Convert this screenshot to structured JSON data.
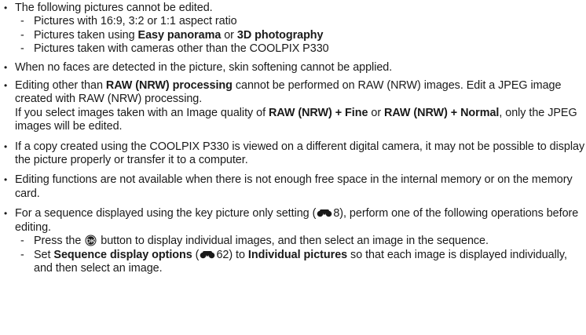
{
  "bullets": {
    "b1": {
      "text": "The following pictures cannot be edited.",
      "subs": [
        "Pictures with 16:9, 3:2 or 1:1 aspect ratio",
        "Pictures taken using ",
        "Easy panorama",
        " or ",
        "3D photography",
        "Pictures taken with cameras other than the COOLPIX P330"
      ]
    },
    "b2": {
      "text": "When no faces are detected in the picture, skin softening cannot be applied."
    },
    "b3": {
      "t1": "Editing other than ",
      "bold1": "RAW (NRW) processing",
      "t2": " cannot be performed on RAW (NRW) images. Edit a JPEG image created with RAW (NRW) processing.",
      "t3": "If you select images taken with an Image quality of ",
      "bold2": "RAW (NRW) + Fine",
      "t4": " or ",
      "bold3": "RAW (NRW) + Normal",
      "t5": ", only the JPEG images will be edited."
    },
    "b4": {
      "text": "If a copy created using the COOLPIX P330 is viewed on a different digital camera, it may not be possible to display the picture properly or transfer it to a computer."
    },
    "b5": {
      "text": "Editing functions are not available when there is not enough free space in the internal memory or on the memory card."
    },
    "b6": {
      "t1": "For a sequence displayed using the key picture only setting (",
      "ref1": "8",
      "t2": "), perform one of the following operations before editing.",
      "sub1_t1": "Press the ",
      "sub1_t2": " button to display individual images, and then select an image in the sequence.",
      "sub2_t1": "Set ",
      "sub2_bold1": "Sequence display options",
      "sub2_t2": " (",
      "ref2": "62",
      "sub2_t3": ") to ",
      "sub2_bold2": "Individual pictures",
      "sub2_t4": " so that each image is displayed individually, and then select an image."
    }
  },
  "symbols": {
    "bullet": "•",
    "dash": "-"
  },
  "icons": {
    "reference": "binoculars-reference-icon",
    "ok_button": "ok-button-icon"
  },
  "colors": {
    "text": "#1a1a1a",
    "icon": "#1a1a1a"
  }
}
